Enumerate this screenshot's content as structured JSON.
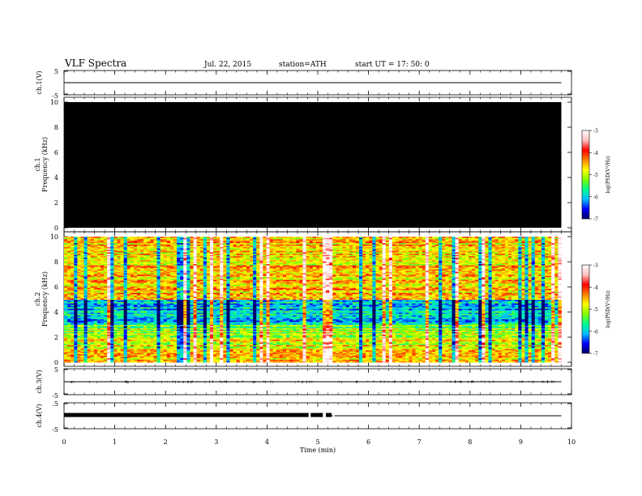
{
  "header": {
    "title": "VLF  Spectra",
    "date": "Jul.  22, 2015",
    "station": "station=ATH",
    "start": "start  UT  =    17: 50: 0"
  },
  "colors": {
    "line": "#000000",
    "background": "#ffffff",
    "spectrogram_empty": "#000000",
    "colormap": [
      "#000066",
      "#0000ff",
      "#00c0ff",
      "#00ff90",
      "#80ff00",
      "#ffff00",
      "#ff8000",
      "#ff0000",
      "#ffc0c0",
      "#ffffff"
    ]
  },
  "chart_data": [
    {
      "type": "line",
      "ylabel": "ch.1(V)",
      "ylim": [
        -5,
        5
      ],
      "yticks": [
        "5",
        "-5"
      ],
      "series": [
        {
          "x": [
            0,
            9.8
          ],
          "values": [
            0,
            0
          ]
        }
      ]
    },
    {
      "type": "heatmap",
      "ylabel_top": "ch.1",
      "ylabel": "Frequency  (kHz)",
      "ylim": [
        0,
        10
      ],
      "yticks": [
        "10",
        "8",
        "6",
        "4",
        "2",
        "0"
      ],
      "state": "no data (uniform black)",
      "colorbar": {
        "label": "log(PSD(V²/Hz)",
        "range": [
          -7,
          -3
        ],
        "ticks": [
          "-3",
          "-4",
          "-5",
          "-6",
          "-7"
        ]
      }
    },
    {
      "type": "heatmap",
      "ylabel_top": "ch.2",
      "ylabel": "Frequency  (kHz)",
      "ylim": [
        0,
        10
      ],
      "yticks": [
        "10",
        "8",
        "6",
        "4",
        "2",
        "0"
      ],
      "description_levels": {
        "band_0_to_2_kHz": -4.8,
        "band_2_to_3_kHz": -5.2,
        "band_3_to_5_kHz": -6.0,
        "band_5_to_10_kHz": -4.6
      },
      "colorbar": {
        "label": "log(PSD(V²/Hz)",
        "range": [
          -7,
          -3
        ],
        "ticks": [
          "-3",
          "-4",
          "-5",
          "-6",
          "-7"
        ]
      }
    },
    {
      "type": "line",
      "ylabel": "ch.3(V)",
      "ylim": [
        -5,
        5
      ],
      "yticks": [
        "5",
        "-5"
      ],
      "series": [
        {
          "x": [
            0,
            9.8
          ],
          "values": [
            0,
            0
          ]
        }
      ]
    },
    {
      "type": "line",
      "ylabel": "ch.4(V)",
      "ylim": [
        -5,
        5
      ],
      "yticks": [
        ".5",
        "-5"
      ],
      "series": [
        {
          "x": [
            0,
            5.4,
            9.8
          ],
          "values": [
            0.3,
            0,
            0
          ]
        }
      ]
    }
  ],
  "xaxis": {
    "label": "Time  (min)",
    "range": [
      0,
      10
    ],
    "ticks": [
      "0",
      "1",
      "2",
      "3",
      "4",
      "5",
      "6",
      "7",
      "8",
      "9",
      "10"
    ]
  }
}
